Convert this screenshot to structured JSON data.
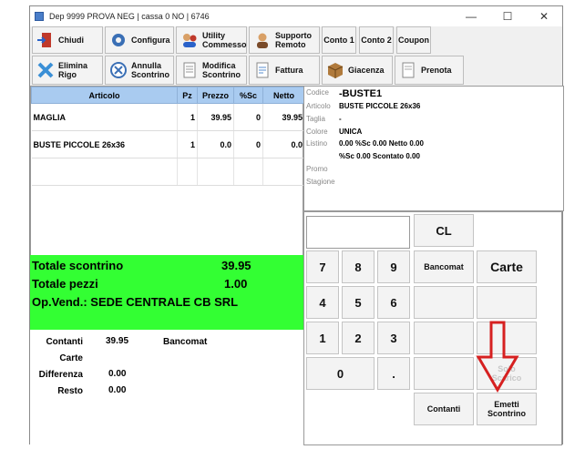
{
  "window": {
    "title": "Dep 9999 PROVA NEG | cassa 0 NO | 6746"
  },
  "toolbar": {
    "chiudi": "Chiudi",
    "configura": "Configura",
    "utility_commesso": [
      "Utility",
      "Commesso"
    ],
    "supporto_remoto": [
      "Supporto",
      "Remoto"
    ],
    "conto1": "Conto 1",
    "conto2": "Conto 2",
    "coupon": "Coupon",
    "elimina_rigo": [
      "Elimina",
      "Rigo"
    ],
    "annulla_scontrino": [
      "Annulla",
      "Scontrino"
    ],
    "modifica_scontrino": [
      "Modifica",
      "Scontrino"
    ],
    "fattura": "Fattura",
    "giacenza": "Giacenza",
    "prenota": "Prenota"
  },
  "grid": {
    "headers": [
      "Articolo",
      "Pz",
      "Prezzo",
      "%Sc",
      "Netto"
    ],
    "rows": [
      [
        "MAGLIA",
        "1",
        "39.95",
        "0",
        "39.95"
      ],
      [
        "BUSTE PICCOLE 26x36",
        "1",
        "0.0",
        "0",
        "0.0"
      ]
    ]
  },
  "details": {
    "codice_label": "Codice",
    "codice": "-BUSTE1",
    "articolo_label": "Articolo",
    "articolo": "BUSTE PICCOLE 26x36",
    "taglia_label": "Taglia",
    "taglia": "-",
    "colore_label": "Colore",
    "colore": "UNICA",
    "listino_label": "Listino",
    "listino": "0.00  %Sc 0.00  Netto 0.00",
    "sconto_line": "%Sc 0.00  Scontato 0.00",
    "promo_label": "Promo",
    "stagione_label": "Stagione"
  },
  "totals": {
    "totale_scontrino_label": "Totale scontrino",
    "totale_scontrino": "39.95",
    "totale_pezzi_label": "Totale pezzi",
    "totale_pezzi": "1.00",
    "op_vend": "Op.Vend.: SEDE CENTRALE CB SRL"
  },
  "payments": {
    "contanti_label": "Contanti",
    "contanti": "39.95",
    "bancomat_label": "Bancomat",
    "carte_label": "Carte",
    "differenza_label": "Differenza",
    "differenza": "0.00",
    "resto_label": "Resto",
    "resto": "0.00"
  },
  "keypad": {
    "cl": "CL",
    "k7": "7",
    "k8": "8",
    "k9": "9",
    "k4": "4",
    "k5": "5",
    "k6": "6",
    "k1": "1",
    "k2": "2",
    "k3": "3",
    "k0": "0",
    "dot": ".",
    "bancomat": "Bancomat",
    "carte": "Carte",
    "solo_scarico": [
      "Solo",
      "Scarico"
    ],
    "contanti": "Contanti",
    "emetti_scontrino": [
      "Emetti",
      "Scontrino"
    ]
  },
  "colors": {
    "green_panel": "#33ff33",
    "grid_header": "#a9cbf0",
    "annotation_arrow": "#d62020"
  }
}
